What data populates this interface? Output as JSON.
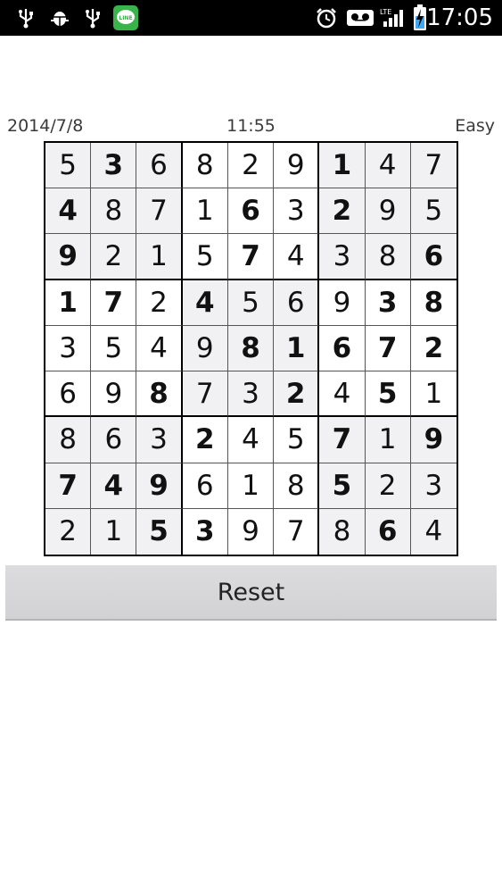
{
  "status_bar": {
    "time": "17:05",
    "lte_label": "LTE",
    "icons": [
      "usb-icon",
      "android-debug-icon",
      "usb-icon",
      "line-app-icon",
      "alarm-icon",
      "voicemail-icon",
      "signal-icon",
      "battery-charging-icon"
    ]
  },
  "info": {
    "date": "2014/7/8",
    "timer": "11:55",
    "level": "Easy"
  },
  "board": {
    "rows": [
      [
        "5",
        "3",
        "6",
        "8",
        "2",
        "9",
        "1",
        "4",
        "7"
      ],
      [
        "4",
        "8",
        "7",
        "1",
        "6",
        "3",
        "2",
        "9",
        "5"
      ],
      [
        "9",
        "2",
        "1",
        "5",
        "7",
        "4",
        "3",
        "8",
        "6"
      ],
      [
        "1",
        "7",
        "2",
        "4",
        "5",
        "6",
        "9",
        "3",
        "8"
      ],
      [
        "3",
        "5",
        "4",
        "9",
        "8",
        "1",
        "6",
        "7",
        "2"
      ],
      [
        "6",
        "9",
        "8",
        "7",
        "3",
        "2",
        "4",
        "5",
        "1"
      ],
      [
        "8",
        "6",
        "3",
        "2",
        "4",
        "5",
        "7",
        "1",
        "9"
      ],
      [
        "7",
        "4",
        "9",
        "6",
        "1",
        "8",
        "5",
        "2",
        "3"
      ],
      [
        "2",
        "1",
        "5",
        "3",
        "9",
        "7",
        "8",
        "6",
        "4"
      ]
    ],
    "given": [
      [
        0,
        1,
        0,
        0,
        0,
        0,
        1,
        0,
        0
      ],
      [
        1,
        0,
        0,
        0,
        1,
        0,
        1,
        0,
        0
      ],
      [
        1,
        0,
        0,
        0,
        1,
        0,
        0,
        0,
        1
      ],
      [
        1,
        1,
        0,
        1,
        0,
        0,
        0,
        1,
        1
      ],
      [
        0,
        0,
        0,
        0,
        1,
        1,
        1,
        1,
        1
      ],
      [
        0,
        0,
        1,
        0,
        0,
        1,
        0,
        1,
        0
      ],
      [
        0,
        0,
        0,
        1,
        0,
        0,
        1,
        0,
        1
      ],
      [
        1,
        1,
        1,
        0,
        0,
        0,
        1,
        0,
        0
      ],
      [
        0,
        0,
        1,
        1,
        0,
        0,
        0,
        1,
        0
      ]
    ]
  },
  "buttons": {
    "reset_label": "Reset"
  }
}
